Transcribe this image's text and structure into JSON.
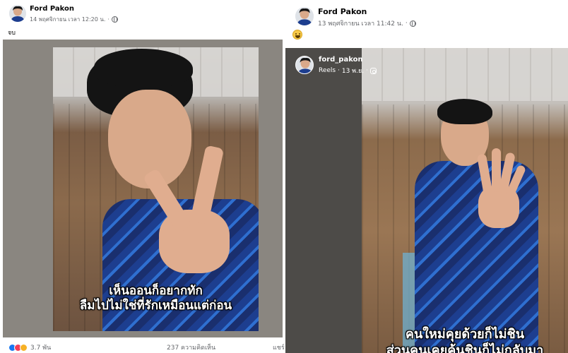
{
  "left_post": {
    "author": "Ford Pakon",
    "timestamp": "14 พฤศจิกายน เวลา 12:20 น.",
    "caption": "จบ",
    "subtitle_line1": "เห็นออนก็อยากทัก",
    "subtitle_line2": "ลืมไปไม่ใช่ที่รักเหมือนแต่ก่อน",
    "reaction_count": "3.7 พัน",
    "comment_count": "237 ความคิดเห็น",
    "share_label": "แชร์"
  },
  "right_post": {
    "author": "Ford Pakon",
    "timestamp": "13 พฤศจิกายน เวลา 11:42 น.",
    "reel": {
      "username": "ford_pakon",
      "meta_prefix": "Reels ·",
      "date": "13 พ.ย.",
      "subtitle_line1": "คนใหม่คุยด้วยก็ไม่ชิน",
      "subtitle_line2": "ส่วนคนเคยคุ้นชินก็ไม่กลับมา"
    }
  },
  "colors": {
    "like": "#1877f2",
    "love": "#f33e58",
    "care": "#f7b125",
    "meta_text": "#65676b"
  },
  "icons": [
    "globe-icon",
    "laughing-emoji-icon",
    "instagram-icon",
    "like-reaction-icon",
    "love-reaction-icon",
    "care-reaction-icon"
  ]
}
